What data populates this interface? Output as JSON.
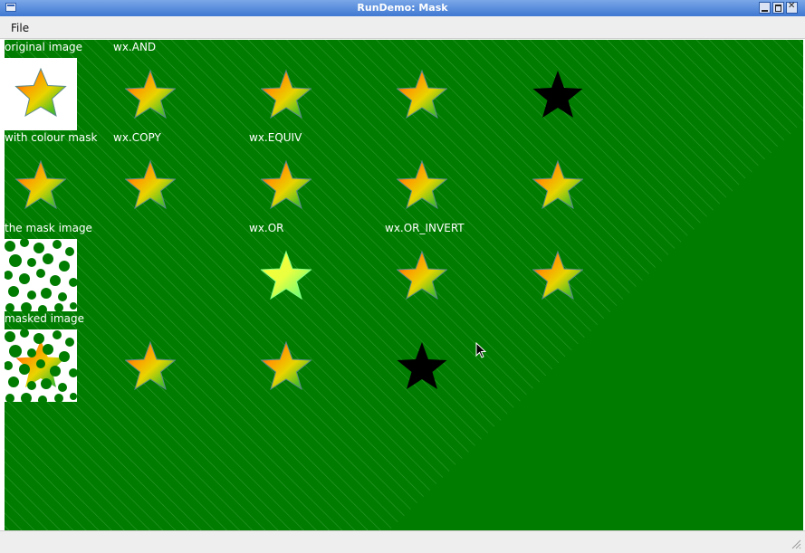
{
  "window": {
    "title": "RunDemo: Mask"
  },
  "menubar": {
    "items": [
      "File"
    ]
  },
  "canvas": {
    "background": "#007c00",
    "labels": {
      "original": "original image",
      "with_mask": "with colour mask",
      "mask_image": "the mask image",
      "masked_image": "masked image",
      "and": "wx.AND",
      "copy": "wx.COPY",
      "equiv": "wx.EQUIV",
      "or": "wx.OR",
      "or_invert": "wx.OR_INVERT"
    },
    "stars": [
      {
        "row": 1,
        "col": 2,
        "style": "gradient"
      },
      {
        "row": 1,
        "col": 3,
        "style": "gradient"
      },
      {
        "row": 1,
        "col": 4,
        "style": "gradient"
      },
      {
        "row": 1,
        "col": 5,
        "style": "black"
      },
      {
        "row": 2,
        "col": 1,
        "style": "gradient"
      },
      {
        "row": 2,
        "col": 2,
        "style": "gradient"
      },
      {
        "row": 2,
        "col": 3,
        "style": "gradient"
      },
      {
        "row": 2,
        "col": 4,
        "style": "gradient"
      },
      {
        "row": 2,
        "col": 5,
        "style": "gradient"
      },
      {
        "row": 3,
        "col": 3,
        "style": "bright"
      },
      {
        "row": 3,
        "col": 4,
        "style": "gradient"
      },
      {
        "row": 3,
        "col": 5,
        "style": "gradient"
      },
      {
        "row": 4,
        "col": 2,
        "style": "gradient"
      },
      {
        "row": 4,
        "col": 3,
        "style": "gradient"
      },
      {
        "row": 4,
        "col": 4,
        "style": "black"
      }
    ]
  }
}
